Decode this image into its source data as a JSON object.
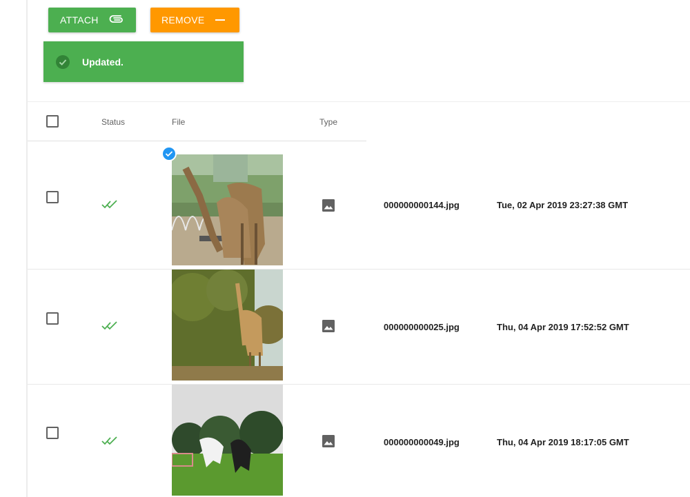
{
  "toolbar": {
    "attach_label": "ATTACH",
    "attach_icon": "paperclip-icon",
    "remove_label": "REMOVE",
    "remove_icon": "minus-icon",
    "attach_color": "#4caf50",
    "remove_color": "#ff9800"
  },
  "toast": {
    "message": "Updated.",
    "icon": "check-circle-icon",
    "color": "#4caf50"
  },
  "table": {
    "columns": [
      "Status",
      "File",
      "Type"
    ],
    "rows": [
      {
        "status_icon": "double-check-icon",
        "type_icon": "image-icon",
        "filename": "000000000144.jpg",
        "date": "Tue, 02 Apr 2019 23:27:38 GMT",
        "thumbnail": "giraffes-in-enclosure",
        "selected": true
      },
      {
        "status_icon": "double-check-icon",
        "type_icon": "image-icon",
        "filename": "000000000025.jpg",
        "date": "Thu, 04 Apr 2019 17:52:52 GMT",
        "thumbnail": "giraffe-eating-from-tree",
        "selected": false
      },
      {
        "status_icon": "double-check-icon",
        "type_icon": "image-icon",
        "filename": "000000000049.jpg",
        "date": "Thu, 04 Apr 2019 18:17:05 GMT",
        "thumbnail": "horses-on-field",
        "selected": false
      }
    ]
  }
}
